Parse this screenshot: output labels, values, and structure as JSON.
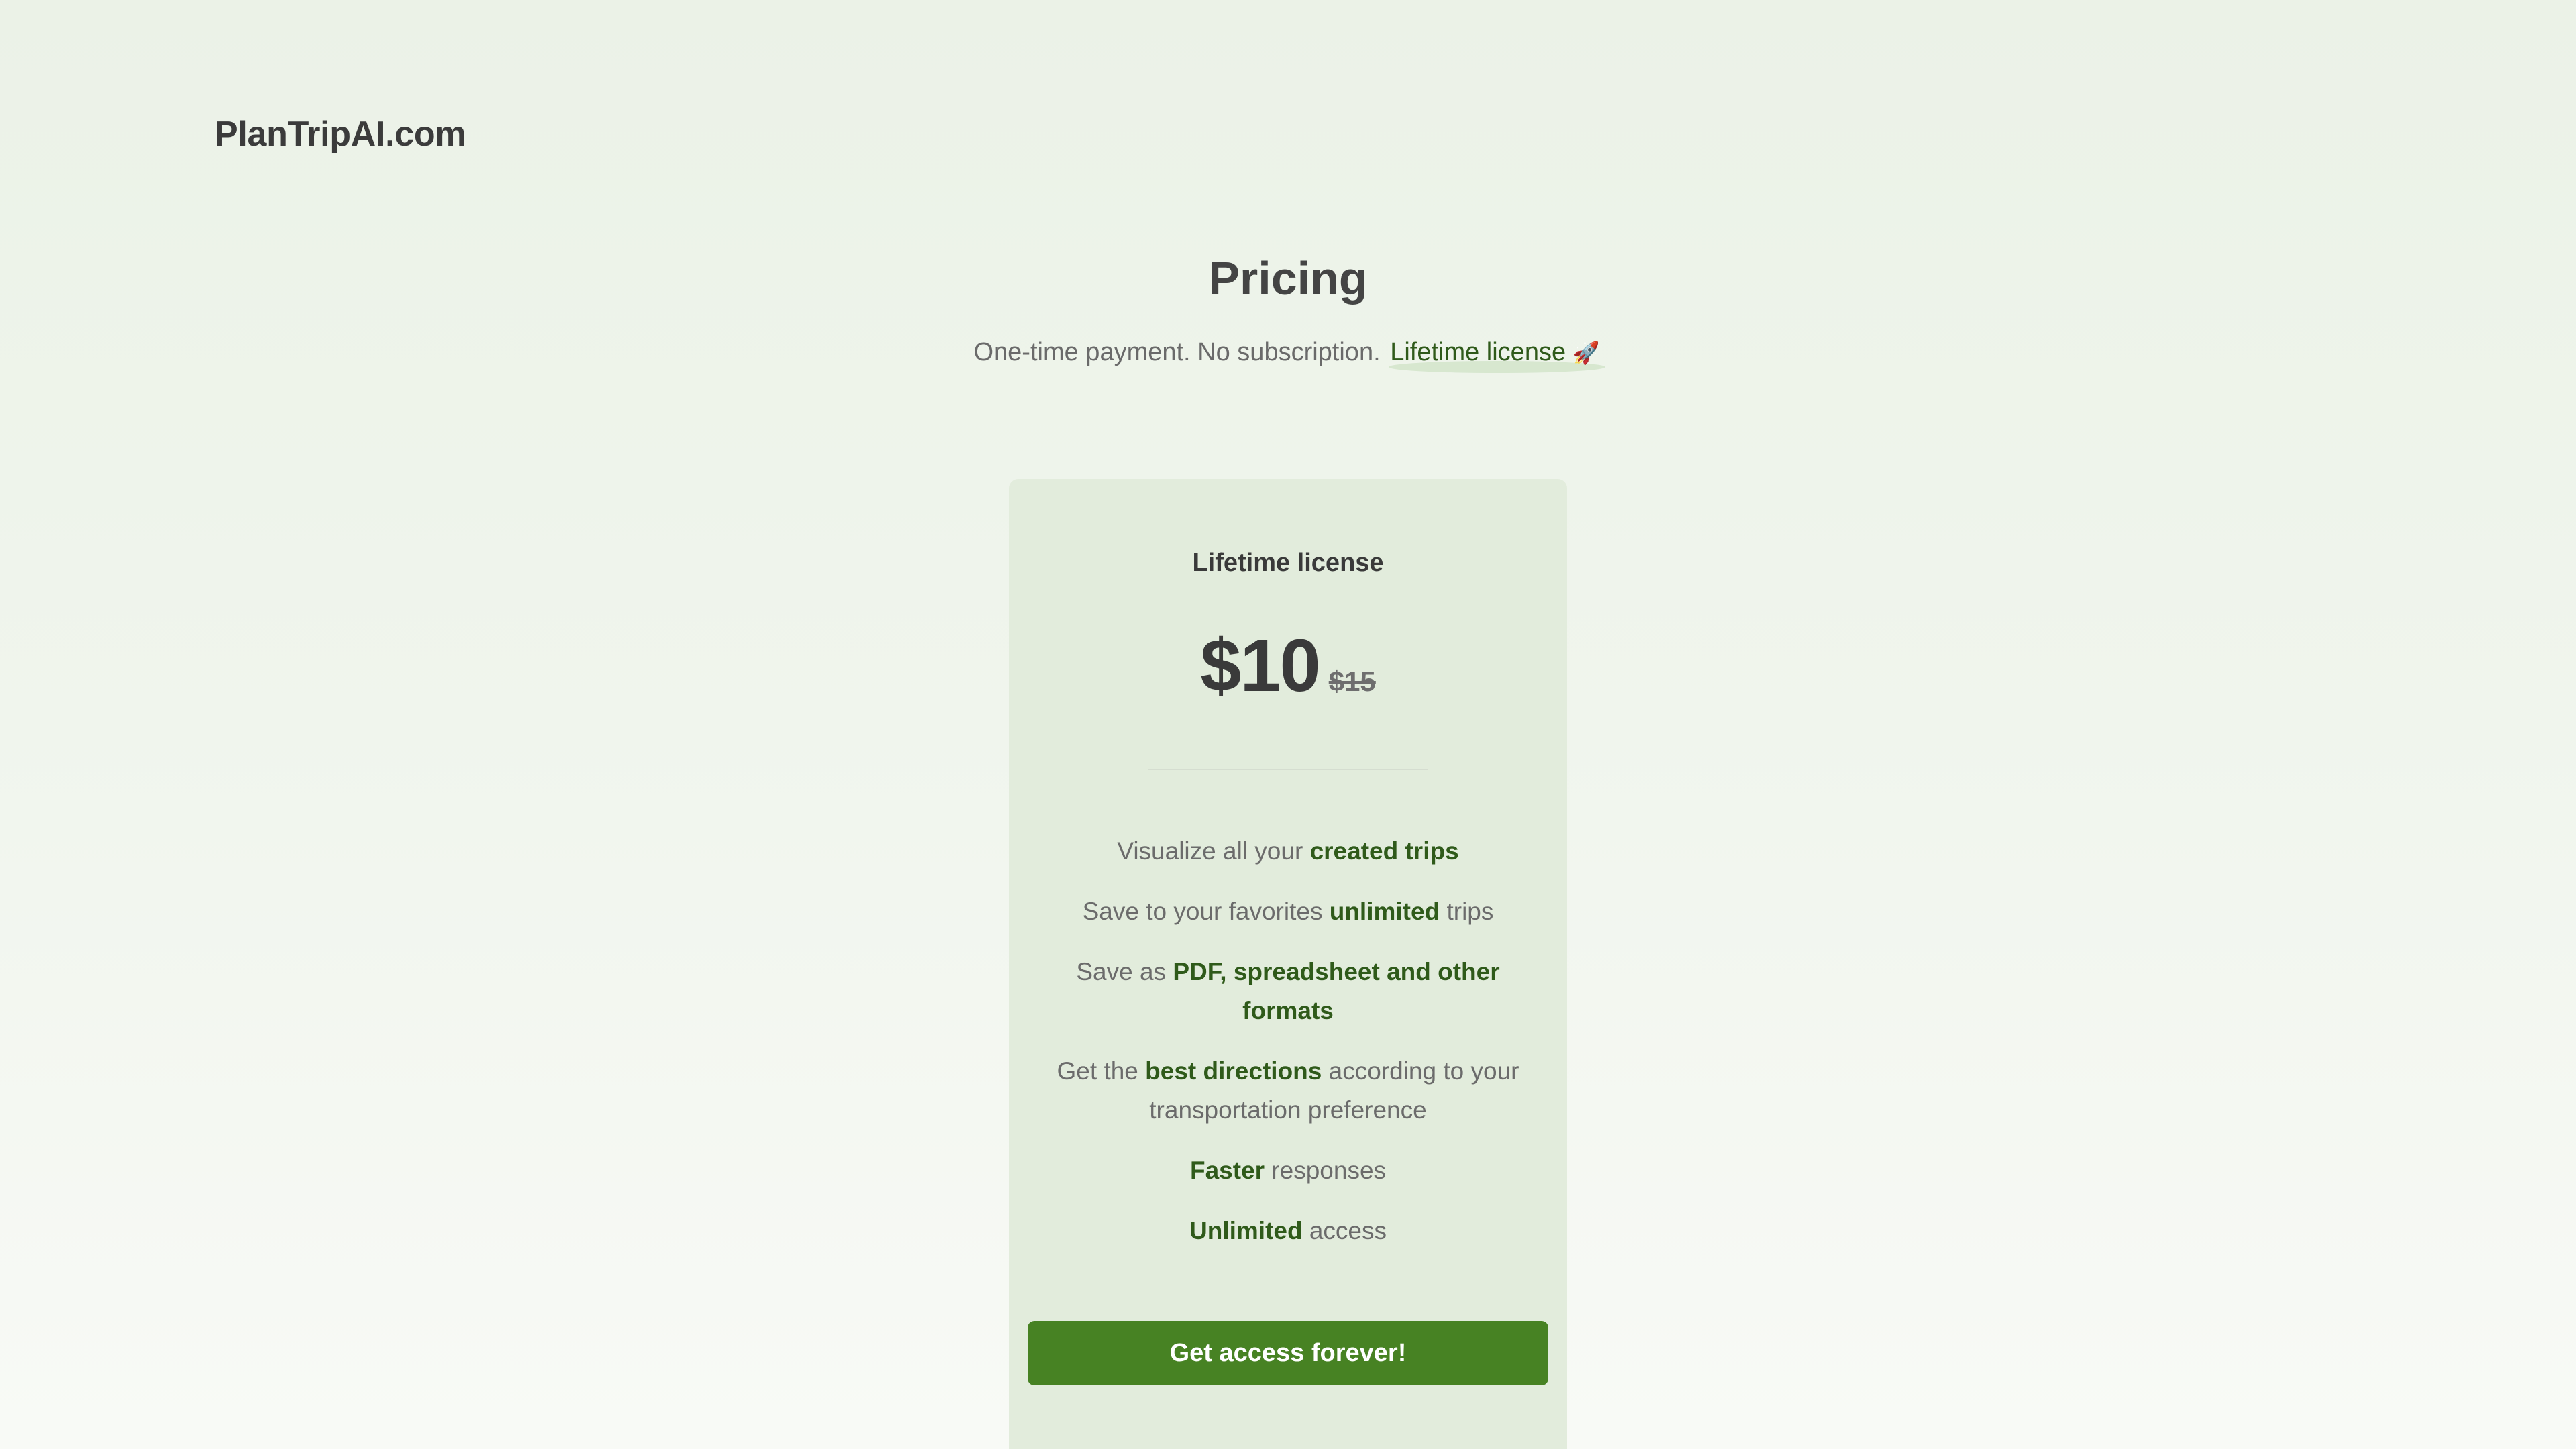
{
  "header": {
    "brand": "PlanTripAI.com"
  },
  "hero": {
    "title": "Pricing",
    "subtitle_prefix": "One-time payment. No subscription. ",
    "subtitle_highlight": "Lifetime license",
    "subtitle_icon": "🚀"
  },
  "plan": {
    "name": "Lifetime license",
    "price": "$10",
    "old_price": "$15",
    "features": [
      {
        "before": "Visualize all your ",
        "highlight": "created trips",
        "after": ""
      },
      {
        "before": "Save to your favorites ",
        "highlight": "unlimited",
        "after": " trips"
      },
      {
        "before": "Save as ",
        "highlight": "PDF, spreadsheet and other formats",
        "after": ""
      },
      {
        "before": "Get the ",
        "highlight": "best directions",
        "after": " according to your transportation preference"
      },
      {
        "before": "",
        "highlight": "Faster",
        "after": " responses"
      },
      {
        "before": "",
        "highlight": "Unlimited",
        "after": " access"
      }
    ],
    "cta_label": "Get access forever!"
  },
  "colors": {
    "accent": "#478223",
    "highlight_text": "#2f5a1a",
    "card_bg": "#e2ecdc"
  }
}
